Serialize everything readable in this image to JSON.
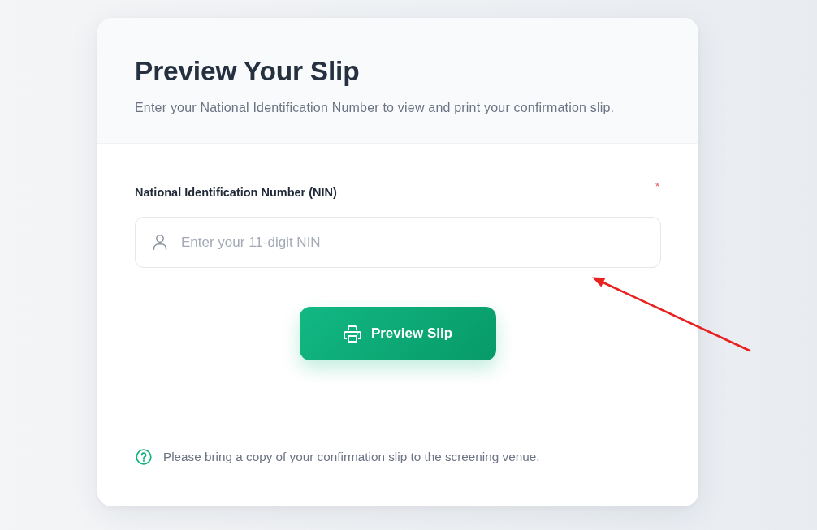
{
  "card": {
    "title": "Preview Your Slip",
    "subtitle": "Enter your National Identification Number to view and print your confirmation slip."
  },
  "form": {
    "field": {
      "label": "National Identification Number (NIN)",
      "required_mark": "*",
      "placeholder": "Enter your 11-digit NIN"
    },
    "button": {
      "label": "Preview Slip"
    }
  },
  "note": {
    "text": "Please bring a copy of your confirmation slip to the screening venue."
  }
}
